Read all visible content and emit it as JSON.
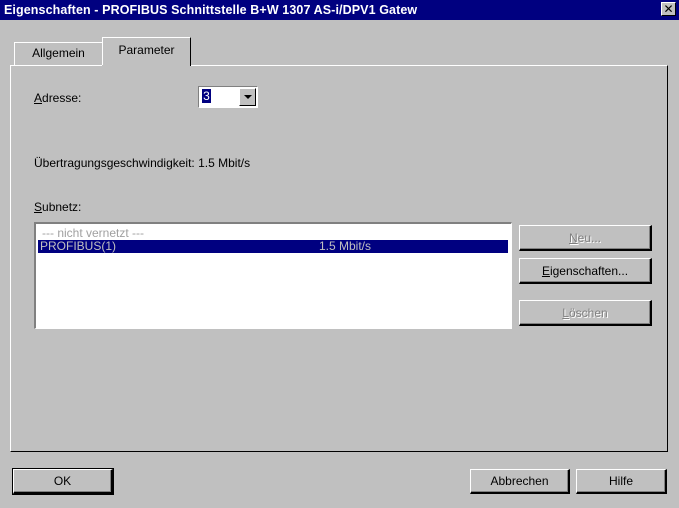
{
  "window": {
    "title": "Eigenschaften - PROFIBUS Schnittstelle  B+W 1307 AS-i/DPV1 Gatew",
    "close_glyph": "✕"
  },
  "tabs": [
    {
      "label": "Allgemein",
      "active": false
    },
    {
      "label": "Parameter",
      "active": true
    }
  ],
  "address": {
    "label_accel": "A",
    "label_rest": "dresse:",
    "value": "3"
  },
  "transfer_rate": {
    "text": "Übertragungsgeschwindigkeit: 1.5 Mbit/s"
  },
  "subnet": {
    "label_accel": "S",
    "label_rest": "ubnetz:",
    "items": [
      {
        "name": "--- nicht vernetzt ---",
        "speed": "",
        "selected": false
      },
      {
        "name": "PROFIBUS(1)",
        "speed": "1.5 Mbit/s",
        "selected": true
      }
    ]
  },
  "subnet_buttons": {
    "new": {
      "accel": "N",
      "rest": "eu...",
      "enabled": false
    },
    "properties": {
      "accel": "E",
      "rest": "igenschaften...",
      "enabled": true
    },
    "delete": {
      "accel": "L",
      "rest": "öschen",
      "enabled": false
    }
  },
  "footer": {
    "ok": "OK",
    "cancel": "Abbrechen",
    "help": "Hilfe"
  },
  "colors": {
    "face": "#c0c0c0",
    "titlebar": "#000080",
    "selection": "#000080"
  }
}
